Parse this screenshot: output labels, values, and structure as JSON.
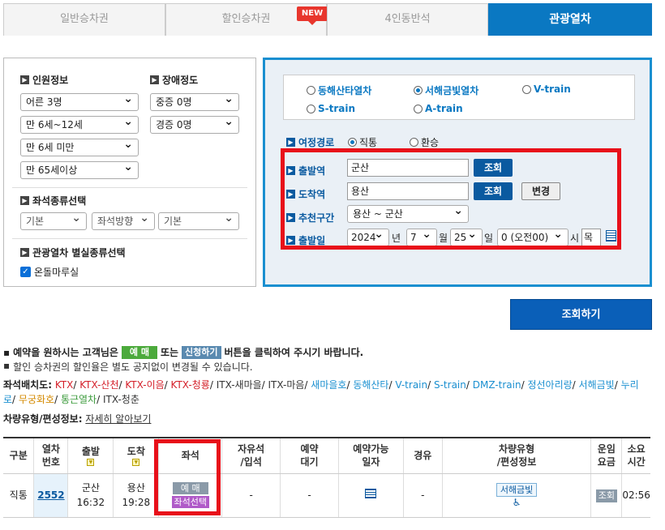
{
  "tabs": [
    {
      "label": "일반승차권"
    },
    {
      "label": "할인승차권",
      "badge": "NEW"
    },
    {
      "label": "4인동반석"
    },
    {
      "label": "관광열차"
    }
  ],
  "left": {
    "people_title": "인원정보",
    "disability_title": "장애정도",
    "adults": "어른 3명",
    "child": "만 6세~12세",
    "infant": "만 6세 미만",
    "senior": "만 65세이상",
    "severe": "중증 0명",
    "mild": "경증 0명",
    "seat_type_title": "좌석종류선택",
    "seat_opts": [
      "기본",
      "좌석방향",
      "기본"
    ],
    "special_title": "관광열차 별실종류선택",
    "special_check": "온돌마루실"
  },
  "right": {
    "trains": [
      "동해산타열차",
      "서해금빛열차",
      "V-train",
      "S-train",
      "A-train"
    ],
    "route_label": "여정경로",
    "route_opts": [
      "직통",
      "환승"
    ],
    "dep_label": "출발역",
    "dep_value": "군산",
    "arr_label": "도착역",
    "arr_value": "용산",
    "query_btn": "조회",
    "swap_btn": "변경",
    "recommend_label": "추천구간",
    "recommend_value": "용산 ~ 군산",
    "date_label": "출발일",
    "year": "2024",
    "year_unit": "년",
    "month": "7",
    "month_unit": "월",
    "day": "25",
    "day_unit": "일",
    "hour": "0 (오전00)",
    "hour_unit": "시",
    "weekday": "목"
  },
  "search_button": "조회하기",
  "notice": {
    "line1_a": "예약을 원하시는 고객님은",
    "reserve_tag": "예 매",
    "line1_b": "또는",
    "apply_tag": "신청하기",
    "line1_c": "버튼을 클릭하여 주시기 바랍니다.",
    "line2": "할인 승차권의 할인율은 별도 공지없이 변경될 수 있습니다."
  },
  "seat_layout": {
    "label": "좌석배치도:",
    "items": [
      {
        "t": "KTX",
        "c": "#d4202a"
      },
      {
        "t": "KTX-산천",
        "c": "#d4202a"
      },
      {
        "t": "KTX-이음",
        "c": "#d4202a"
      },
      {
        "t": "KTX-청룡",
        "c": "#d4202a"
      },
      {
        "t": "ITX-새마을",
        "c": "#333333"
      },
      {
        "t": "ITX-마음",
        "c": "#333333"
      },
      {
        "t": "새마을호",
        "c": "#1a8fd0"
      },
      {
        "t": "동해산타",
        "c": "#1a8fd0"
      },
      {
        "t": "V-train",
        "c": "#1a8fd0"
      },
      {
        "t": "S-train",
        "c": "#1a8fd0"
      },
      {
        "t": "DMZ-train",
        "c": "#1a8fd0"
      },
      {
        "t": "정선아리랑",
        "c": "#1a8fd0"
      },
      {
        "t": "서해금빛",
        "c": "#1a8fd0"
      },
      {
        "t": "누리로",
        "c": "#1a8fd0"
      },
      {
        "t": "무궁화호",
        "c": "#d48a00"
      },
      {
        "t": "통근열차",
        "c": "#3a9a3a"
      },
      {
        "t": "ITX-청춘",
        "c": "#333333"
      }
    ]
  },
  "vehicle_info": {
    "label": "차량유형/편성정보:",
    "link": "자세히 알아보기"
  },
  "table": {
    "headers": [
      "구분",
      "열차\n번호",
      "출발",
      "도착",
      "좌석",
      "자유석\n/입석",
      "예약\n대기",
      "예약가능\n일자",
      "경유",
      "차량유형\n/편성정보",
      "운임\n요금",
      "소요\n시간"
    ],
    "row": {
      "type": "직통",
      "train_no": "2552",
      "dep_station": "군산",
      "dep_time": "16:32",
      "arr_station": "용산",
      "arr_time": "19:28",
      "reserve": "예 매",
      "seat_select": "좌석선택",
      "free_seat": "-",
      "waiting": "-",
      "via": "-",
      "vehicle": "서해금빛",
      "fare": "조회",
      "duration": "02:56"
    }
  }
}
